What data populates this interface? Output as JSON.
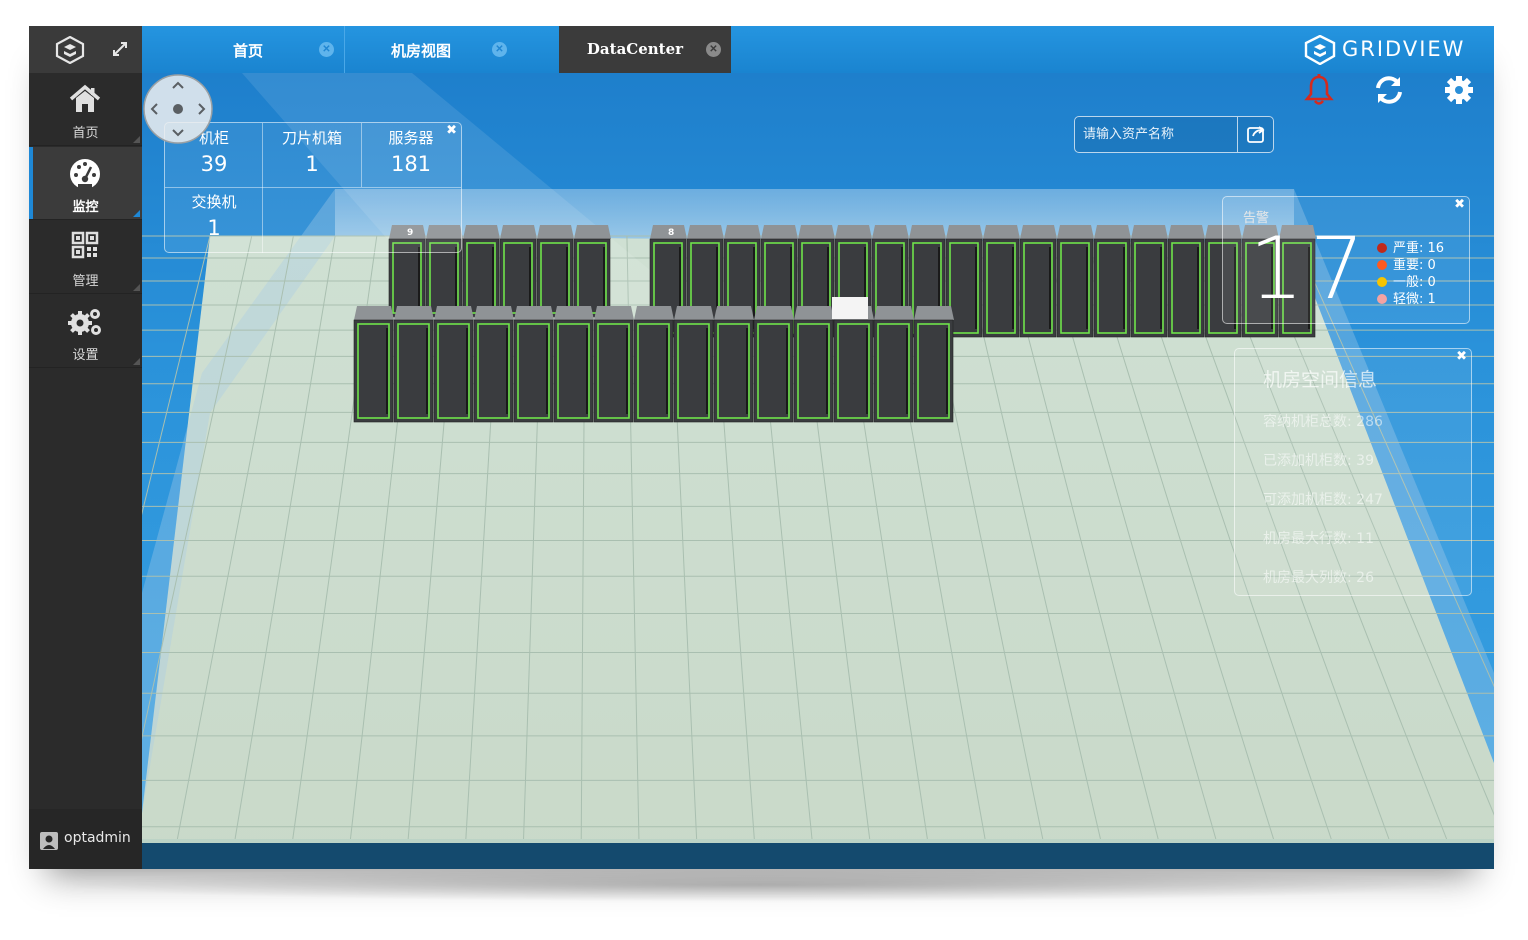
{
  "sidebar": {
    "items": [
      {
        "id": "home",
        "label": "首页",
        "icon": "home-icon",
        "active": false
      },
      {
        "id": "monitor",
        "label": "监控",
        "icon": "dashboard-gauge-icon",
        "active": true
      },
      {
        "id": "manage",
        "label": "管理",
        "icon": "qr-grid-icon",
        "active": false
      },
      {
        "id": "settings",
        "label": "设置",
        "icon": "gears-icon",
        "active": false
      }
    ],
    "user": {
      "name": "optadmin",
      "icon": "user-icon"
    }
  },
  "tabs": [
    {
      "label": "首页",
      "active": false
    },
    {
      "label": "机房视图",
      "active": false
    },
    {
      "label": "DataCenter",
      "active": true
    }
  ],
  "brand": {
    "name": "GRIDVIEW"
  },
  "search": {
    "placeholder": "请输入资产名称"
  },
  "stats": {
    "cabinet": {
      "label": "机柜",
      "value": "39"
    },
    "blade": {
      "label": "刀片机箱",
      "value": "1"
    },
    "server": {
      "label": "服务器",
      "value": "181"
    },
    "switch": {
      "label": "交换机",
      "value": "1"
    }
  },
  "alarm": {
    "title": "告警",
    "total": "17",
    "levels": [
      {
        "label": "严重: 16",
        "color": "#c0291b"
      },
      {
        "label": "重要: 0",
        "color": "#ff5a1f"
      },
      {
        "label": "一般: 0",
        "color": "#f5c400"
      },
      {
        "label": "轻微: 1",
        "color": "#f3a3a3"
      }
    ]
  },
  "room_info": {
    "title": "机房空间信息",
    "lines": [
      "容纳机柜总数: 286",
      "已添加机柜数: 39",
      "可添加机柜数: 247",
      "机房最大行数: 11",
      "机房最大列数: 26"
    ]
  },
  "scene": {
    "row_labels": [
      "9",
      "8"
    ],
    "colors": {
      "floor": "#d4e2d4",
      "rack": "#3a3c3f",
      "rack_led": "#6fe34a",
      "sky": "#2a92da"
    }
  }
}
